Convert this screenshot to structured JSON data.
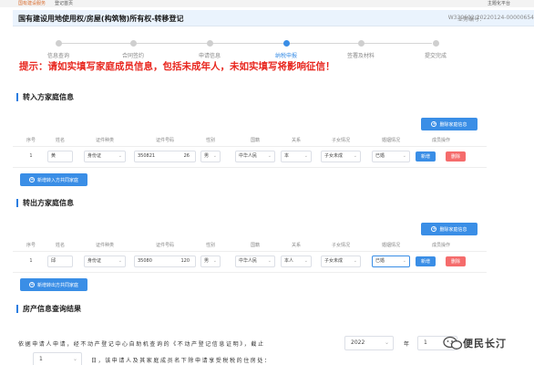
{
  "topbar": {
    "left_a": "国有建设服务",
    "left_b": "登记首页",
    "right": "主题化平台"
  },
  "header": {
    "title": "国有建设用地使用权/房屋(构筑物)所有权-转移登记",
    "biz_label": "业务编号：",
    "biz_no": "W330602-20220124-00000654"
  },
  "steps": [
    {
      "label": "信息查询",
      "active": false
    },
    {
      "label": "合同签约",
      "active": false
    },
    {
      "label": "申请信息",
      "active": false
    },
    {
      "label": "纳税申报",
      "active": true
    },
    {
      "label": "签署及材料",
      "active": false
    },
    {
      "label": "提交完成",
      "active": false
    }
  ],
  "warning": "提示：请如实填写家庭成员信息，包括未成年人，未如实填写将影响征信！",
  "columns": [
    "序号",
    "姓名",
    "证件种类",
    "证件号码",
    "性别",
    "国籍",
    "关系",
    "子女情况",
    "婚姻情况",
    "成员操作"
  ],
  "section_in": {
    "title": "转入方家庭信息",
    "delete_label": "删除家庭信息",
    "add_label": "新增转入方共同家庭",
    "row": {
      "index": "1",
      "name": "黄",
      "id_type": "身份证",
      "id_no": "350821",
      "id_no_tail": "26",
      "gender": "男",
      "nationality": "中华人民",
      "relation": "本",
      "children": "子女未成",
      "marital": "已婚",
      "edit_label": "新增",
      "del_label": "删除"
    }
  },
  "section_out": {
    "title": "转出方家庭信息",
    "delete_label": "删除家庭信息",
    "add_label": "新增转出方共同家庭",
    "row": {
      "index": "1",
      "name": "邱",
      "id_type": "身份证",
      "id_no": "35080",
      "id_no_tail": "120",
      "gender": "男",
      "nationality": "中华人民",
      "relation": "本人",
      "children": "子女未成",
      "marital": "已婚",
      "edit_label": "新增",
      "del_label": "删除"
    }
  },
  "property": {
    "title": "房产信息查询结果",
    "line1": "依据申请人申请，经不动产登记中心自助机查询的《不动产登记信息证明》，截止",
    "year": "2022",
    "year_label": "年",
    "month": "1",
    "day": "1",
    "line2": "日，该申请人及其家庭成员名下除申请享受税税的住房处："
  },
  "watermark": {
    "text": "便民长汀"
  }
}
